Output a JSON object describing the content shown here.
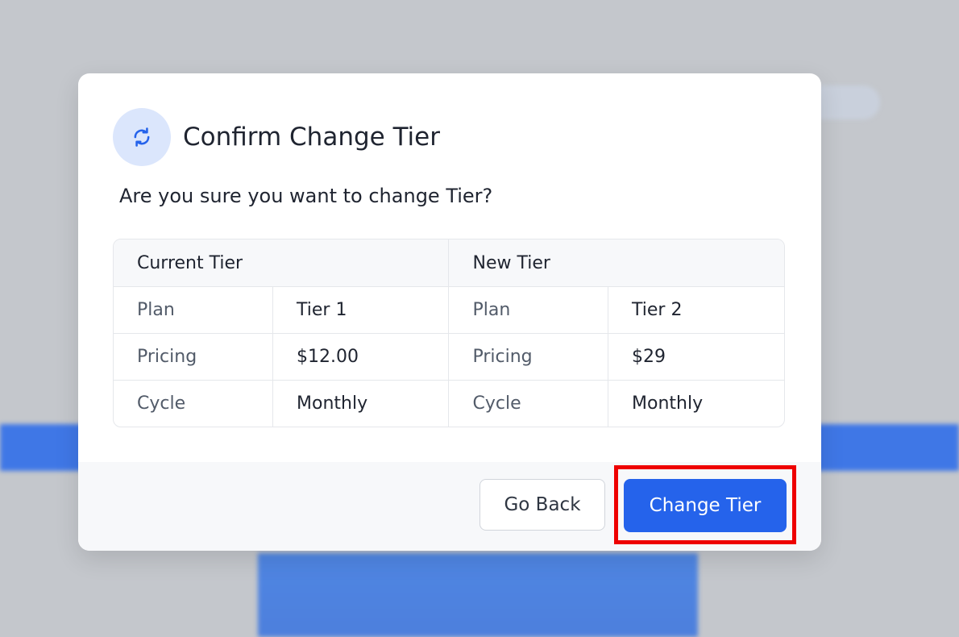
{
  "modal": {
    "title": "Confirm Change Tier",
    "question": "Are you sure you want to change Tier?",
    "icon": "refresh-icon",
    "accent_color": "#2563eb",
    "table": {
      "headers": [
        "Current Tier",
        "New Tier"
      ],
      "rows": [
        {
          "current_label": "Plan",
          "current_value": "Tier 1",
          "new_label": "Plan",
          "new_value": "Tier 2"
        },
        {
          "current_label": "Pricing",
          "current_value": "$12.00",
          "new_label": "Pricing",
          "new_value": "$29"
        },
        {
          "current_label": "Cycle",
          "current_value": "Monthly",
          "new_label": "Cycle",
          "new_value": "Monthly"
        }
      ]
    },
    "buttons": {
      "back_label": "Go Back",
      "change_label": "Change Tier"
    }
  },
  "highlight": {
    "color": "#ee0000",
    "target": "change-tier-button"
  }
}
